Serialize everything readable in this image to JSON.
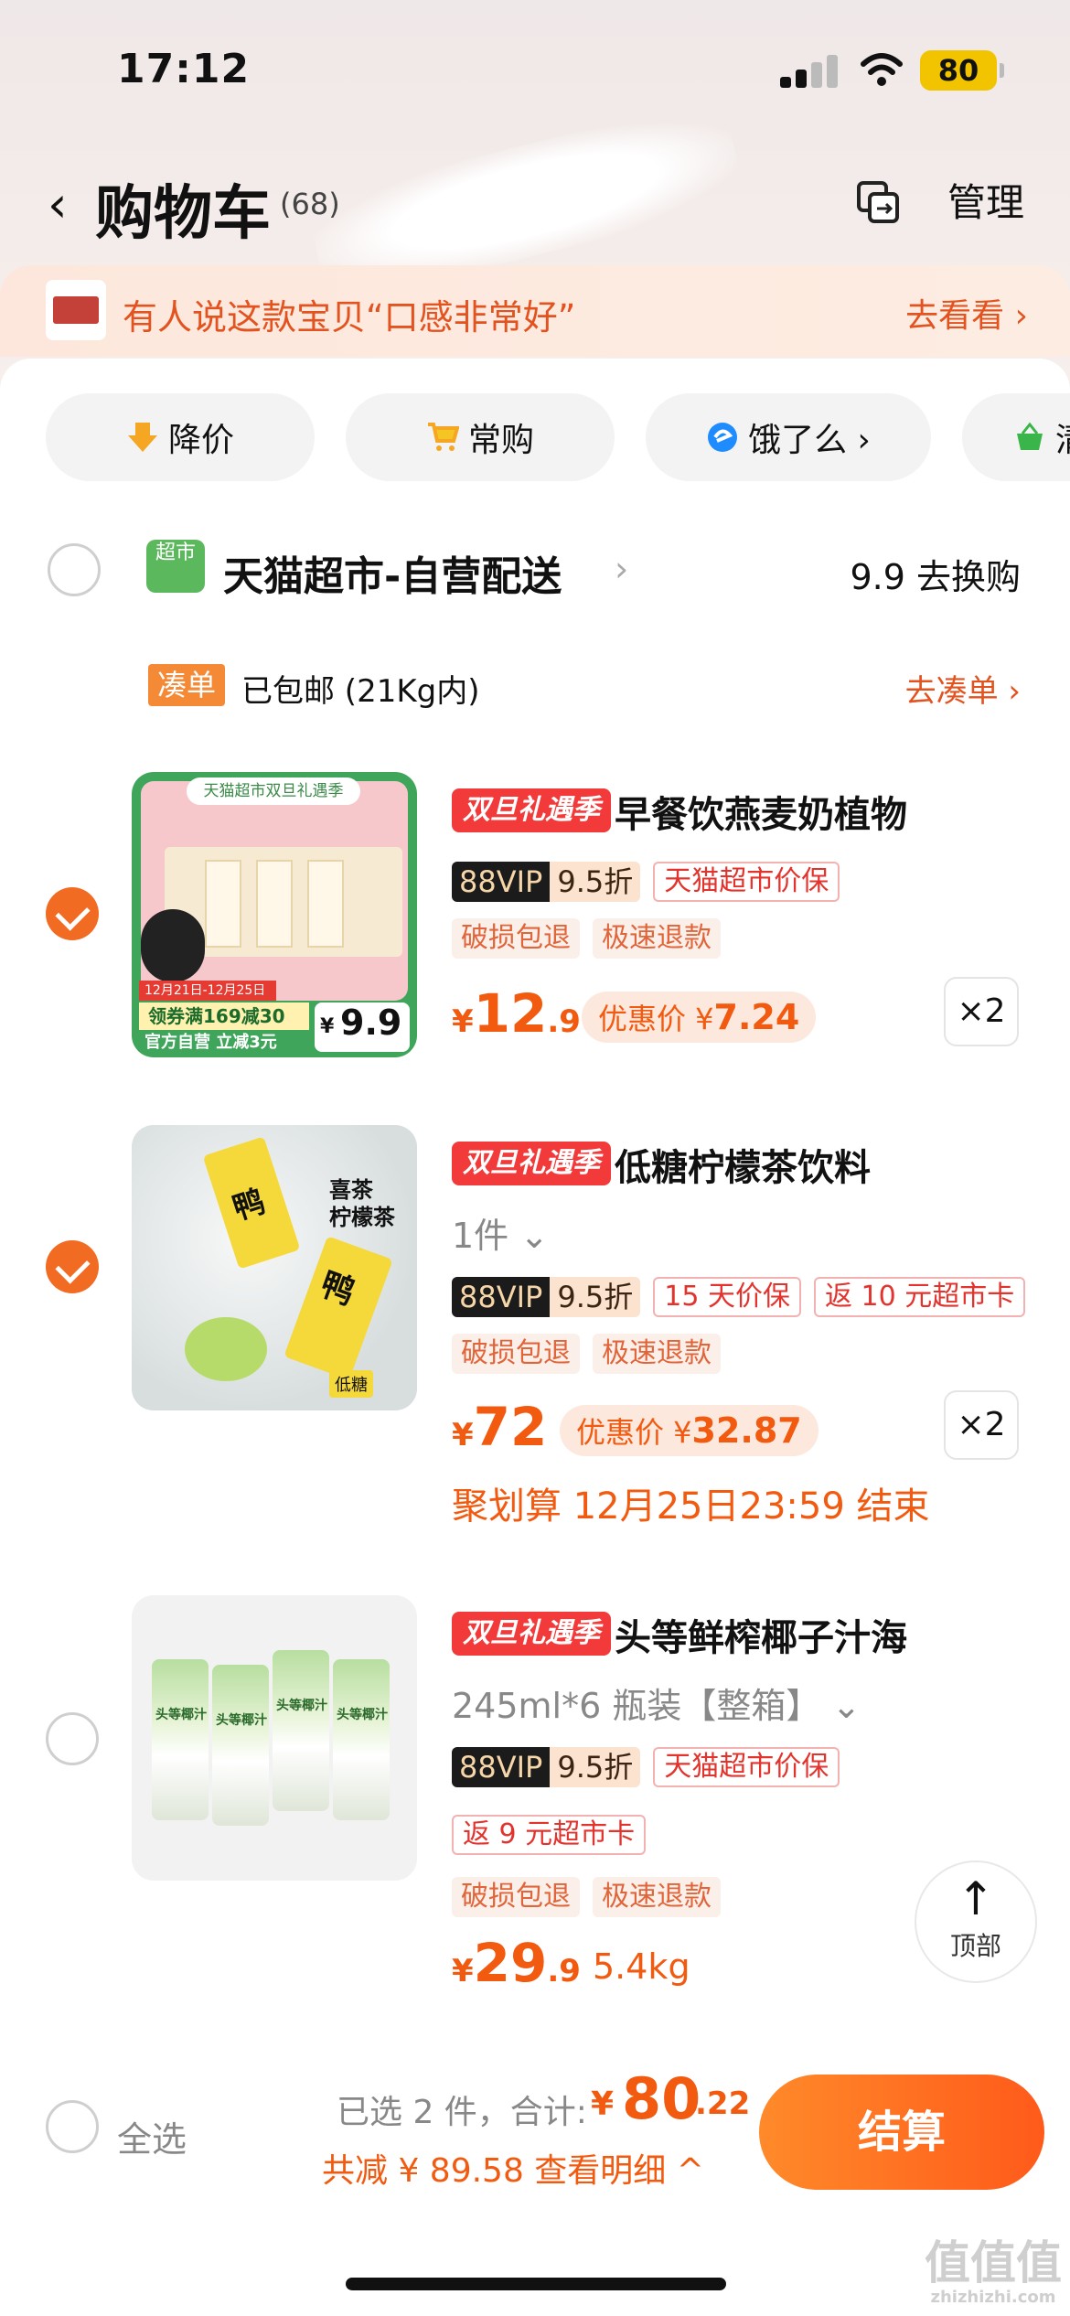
{
  "status": {
    "time": "17:12",
    "battery": "80"
  },
  "nav": {
    "back_icon": "chevron-left-icon",
    "title": "购物车",
    "count": "(68)",
    "manage": "管理"
  },
  "hint": {
    "text": "有人说这款宝贝“口感非常好”",
    "action": "去看看 ›"
  },
  "chips": [
    {
      "label": "降价",
      "icon": "price-down-icon"
    },
    {
      "label": "常购",
      "icon": "cart-icon"
    },
    {
      "label": "饿了么 ›",
      "icon": "eleme-icon"
    },
    {
      "label": "清",
      "icon": "basket-icon"
    }
  ],
  "shop": {
    "logo": "超市",
    "name": "天猫超市-自营配送",
    "right": "9.9 去换购"
  },
  "shipping": {
    "tag": "凑单",
    "text": "已包邮 (21Kg内)",
    "action": "去凑单 ›"
  },
  "items": [
    {
      "promo": "双旦礼遇季",
      "name": "早餐饮燕麦奶植物",
      "vip": "88VIP",
      "vip_off": "9.5折",
      "tags": [
        "天猫超市价保"
      ],
      "service": [
        "破损包退",
        "极速退款"
      ],
      "price_int": "12",
      "price_dec": ".9",
      "disc_label": "优惠价 ¥",
      "disc_value": "7.24",
      "qty": "×2",
      "checked": true,
      "img_texts": {
        "banner": "天猫超市双旦礼遇季",
        "date": "12月21日-12月25日",
        "coupon": "领券满169减30",
        "self": "官方自营 立减3元",
        "price": "9.9",
        "price_label": "¥"
      }
    },
    {
      "promo": "双旦礼遇季",
      "name": "低糖柠檬茶饮料",
      "spec": "1件 ⌄",
      "vip": "88VIP",
      "vip_off": "9.5折",
      "tags": [
        "15 天价保",
        "返 10 元超市卡"
      ],
      "service": [
        "破损包退",
        "极速退款"
      ],
      "price_int": "72",
      "disc_label": "优惠价 ¥",
      "disc_value": "32.87",
      "qty": "×2",
      "checked": true,
      "deal": "聚划算 12月25日23:59 结束",
      "img_texts": {
        "brand": "喜茶\n柠檬茶",
        "duck": "鸭",
        "low": "低糖"
      }
    },
    {
      "promo": "双旦礼遇季",
      "name": "头等鲜榨椰子汁海",
      "spec": "245ml*6 瓶装【整箱】 ⌄",
      "vip": "88VIP",
      "vip_off": "9.5折",
      "tags": [
        "天猫超市价保"
      ],
      "tags2": [
        "返 9 元超市卡"
      ],
      "service": [
        "破损包退",
        "极速退款"
      ],
      "price_int": "29",
      "price_dec": ".9",
      "weight": "5.4kg",
      "checked": false,
      "img_texts": {
        "can": "头等椰汁"
      }
    }
  ],
  "top_button": {
    "arrow": "↑",
    "label": "顶部"
  },
  "footer": {
    "select_all": "全选",
    "selected": "已选 2 件，合计:",
    "currency": "¥",
    "total_int": "80",
    "total_dec": ".22",
    "saved": "共减 ¥ 89.58  查看明细 ^",
    "checkout": "结算"
  },
  "watermark": {
    "text": "值值值",
    "sub": "zhizhizhi.com"
  },
  "colors": {
    "accent": "#f25a10",
    "promo": "#f23a3a",
    "check": "#f26b22"
  }
}
